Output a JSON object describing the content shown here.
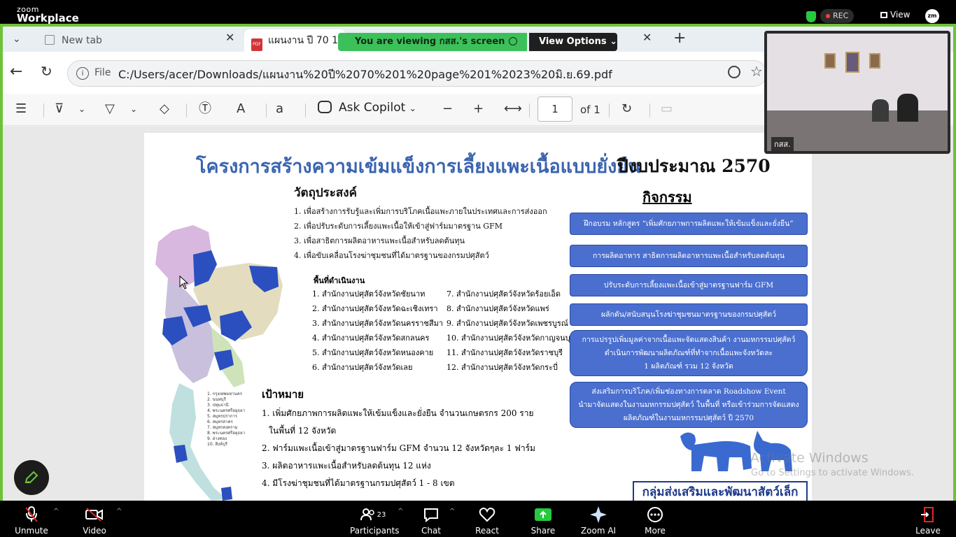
{
  "zoom": {
    "logo_line1": "zoom",
    "logo_line2": "Workplace",
    "rec_label": "REC",
    "view_label": "View",
    "avatar_initials": "zm",
    "viewing_banner": "You are viewing  กสส.'s screen",
    "view_options": "View Options",
    "participants_count": "23",
    "participant_name": "กสส.",
    "toolbar": {
      "unmute": "Unmute",
      "video": "Video",
      "participants": "Participants",
      "chat": "Chat",
      "react": "React",
      "share": "Share",
      "zoom_ai": "Zoom AI",
      "more": "More",
      "leave": "Leave"
    }
  },
  "browser": {
    "tabs": [
      {
        "label": "New tab"
      },
      {
        "label": "แผนงาน ปี 70 1"
      }
    ],
    "url_prefix": "File",
    "url": "C:/Users/acer/Downloads/แผนงาน%20ปี%2070%201%20page%201%2023%20มิ.ย.69.pdf",
    "pdf_toolbar": {
      "ask_copilot": "Ask Copilot",
      "page_current": "1",
      "page_total": "of 1"
    }
  },
  "document": {
    "title": "โครงการสร้างความเข้มแข็งการเลี้ยงแพะเนื้อแบบยั่งยืน",
    "year": "ปีงบประมาณ 2570",
    "objectives_heading": "วัตถุประสงค์",
    "objectives": [
      "1. เพื่อสร้างการรับรู้และเพิ่มการบริโภคเนื้อแพะภายในประเทศและการส่งออก",
      "2. เพื่อปรับระดับการเลี้ยงแพะเนื้อให้เข้าสู่ฟาร์มมาตรฐาน GFM",
      "3. เพื่อสาธิตการผลิตอาหารแพะเนื้อสำหรับลดต้นทุน",
      "4. เพื่อขับเคลื่อนโรงฆ่าชุมชนที่ได้มาตรฐานของกรมปศุสัตว์"
    ],
    "areas_heading": "พื้นที่ดำเนินงาน",
    "areas_left": [
      "1. สำนักงานปศุสัตว์จังหวัดชัยนาท",
      "2. สำนักงานปศุสัตว์จังหวัดฉะเชิงเทรา",
      "3. สำนักงานปศุสัตว์จังหวัดนครราชสีมา",
      "4. สำนักงานปศุสัตว์จังหวัดสกลนคร",
      "5. สำนักงานปศุสัตว์จังหวัดหนองคาย",
      "6. สำนักงานปศุสัตว์จังหวัดเลย"
    ],
    "areas_right": [
      "7. สำนักงานปศุสัตว์จังหวัดร้อยเอ็ด",
      "8. สำนักงานปศุสัตว์จังหวัดแพร่",
      "9. สำนักงานปศุสัตว์จังหวัดเพชรบูรณ์",
      "10. สำนักงานปศุสัตว์จังหวัดกาญจนบุรี",
      "11. สำนักงานปศุสัตว์จังหวัดราชบุรี",
      "12. สำนักงานปศุสัตว์จังหวัดกระบี่"
    ],
    "goals_heading": "เป้าหมาย",
    "goals": [
      "1. เพิ่มศักยภาพการผลิตแพะให้เข้มแข็งและยั่งยืน จำนวนเกษตรกร 200 ราย",
      "   ในพื้นที่ 12 จังหวัด",
      "2. ฟาร์มแพะเนื้อเข้าสู่มาตรฐานฟาร์ม GFM จำนวน 12 จังหวัดๆละ 1 ฟาร์ม",
      "3. ผลิตอาหารแพะเนื้อสำหรับลดต้นทุน 12 แห่ง",
      "4. มีโรงฆ่าชุมชนที่ได้มาตรฐานกรมปศุสัตว์ 1 - 8 เขต"
    ],
    "activities_heading": "กิจกรรม",
    "activities": [
      {
        "lines": [
          "ฝึกอบรม หลักสูตร “เพิ่มศักยภาพการผลิตแพะให้เข้มแข็งและยั่งยืน”"
        ]
      },
      {
        "lines": [
          "การผลิตอาหาร สาธิตการผลิตอาหารแพะเนื้อสำหรับลดต้นทุน"
        ]
      },
      {
        "lines": [
          "ปรับระดับการเลี้ยงแพะเนื้อเข้าสู่มาตรฐานฟาร์ม GFM"
        ]
      },
      {
        "lines": [
          "ผลักดัน/สนับสนุนโรงฆ่าชุมชนมาตรฐานของกรมปศุสัตว์"
        ]
      },
      {
        "lines": [
          "การแปรรูปเพิ่มมูลค่าจากเนื้อแพะจัดแสดงสินค้า งานมหกรรมปศุสัตว์",
          "ดำเนินการพัฒนาผลิตภัณฑ์ที่ทำจากเนื้อแพะจังหวัดละ",
          "1 ผลิตภัณฑ์ รวม 12 จังหวัด"
        ]
      },
      {
        "lines": [
          "ส่งเสริมการบริโภค/เพิ่มช่องทางการตลาด Roadshow Event",
          "นำมาจัดแสดงในงานมหกรรมปศุสัตว์ ในพื้นที่ หรือเข้าร่วมการจัดแสดง",
          "ผลิตภัณฑ์ในงานมหกรรมปศุสัตว์ ปี 2570"
        ]
      }
    ],
    "brand": "กลุ่มส่งเสริมและพัฒนาสัตว์เล็ก",
    "map_legend": [
      "1. กรุงเทพมหานคร",
      "2. นนทบุรี",
      "3. ปทุมธานี",
      "4. พระนครศรีอยุธยา",
      "5. สมุทรปราการ",
      "6. สมุทรสาคร",
      "7. สมุทรสงคราม",
      "8. พระนครศรีอยุธยา",
      "9. อ่างทอง",
      "10. สิงห์บุรี"
    ]
  },
  "os": {
    "activate_title": "Activate Windows",
    "activate_sub": "Go to Settings to activate Windows."
  },
  "colors": {
    "share_border": "#6ec23a",
    "activity_box": "#4a6fcf",
    "title_blue": "#3a64b0"
  }
}
